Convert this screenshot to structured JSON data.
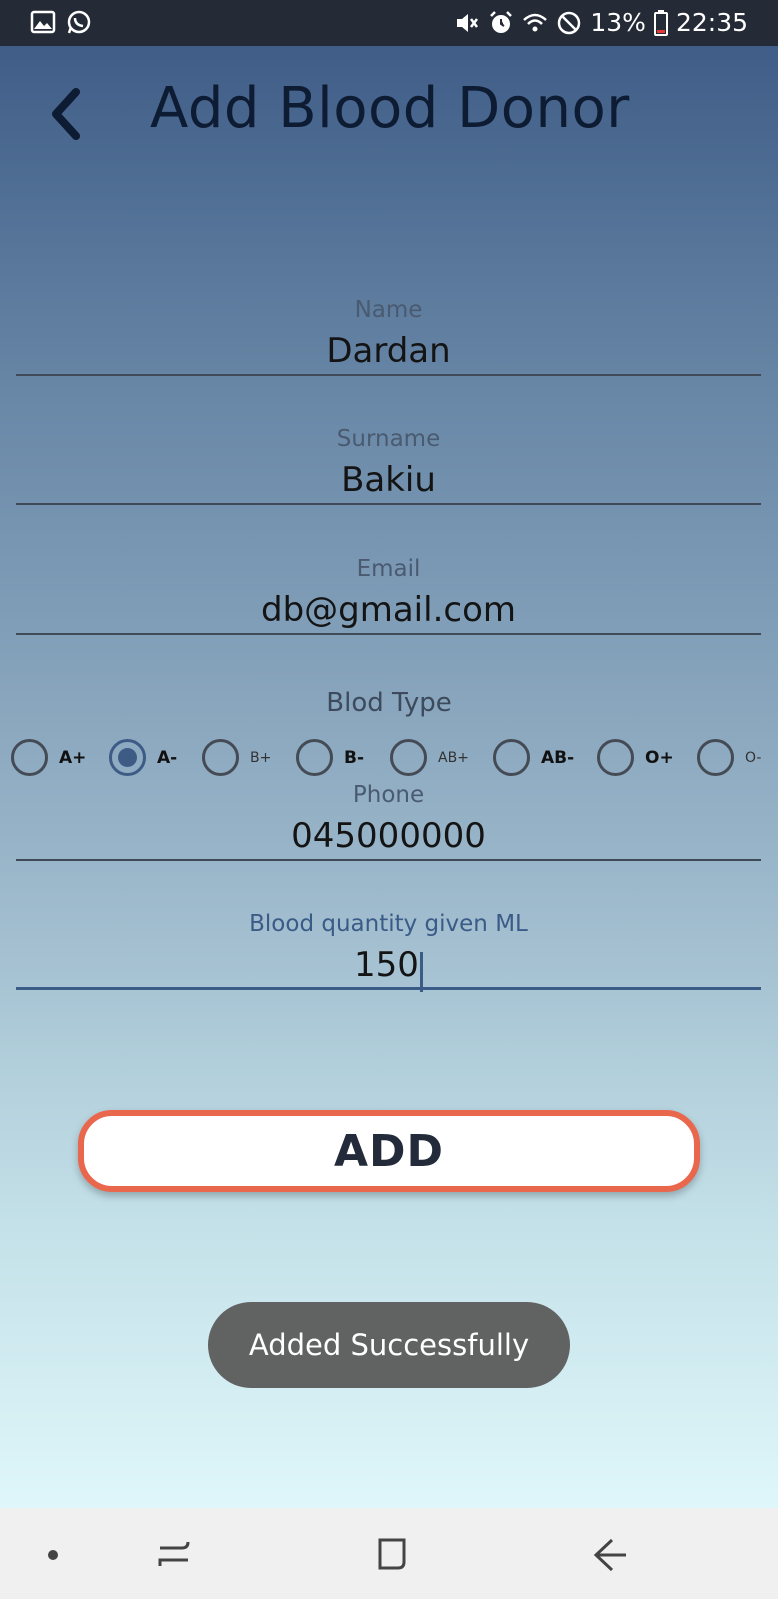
{
  "status_bar": {
    "battery": "13%",
    "time": "22:35",
    "icons": [
      "image-icon",
      "whatsapp-icon",
      "mute-icon",
      "alarm-icon",
      "wifi-icon",
      "do-not-disturb-icon",
      "battery-icon"
    ]
  },
  "header": {
    "title": "Add Blood Donor",
    "back_icon": "chevron-left-icon"
  },
  "form": {
    "name": {
      "label": "Name",
      "value": "Dardan"
    },
    "surname": {
      "label": "Surname",
      "value": "Bakiu"
    },
    "email": {
      "label": "Email",
      "value": "db@gmail.com"
    },
    "blood_type": {
      "label": "Blod Type",
      "options": [
        "A+",
        "A-",
        "B+",
        "B-",
        "AB+",
        "AB-",
        "O+",
        "O-"
      ],
      "selected": "A-"
    },
    "phone": {
      "label": "Phone",
      "value": "045000000"
    },
    "quantity": {
      "label": "Blood quantity given ML",
      "value": "150"
    }
  },
  "add_button": {
    "label": "ADD"
  },
  "toast": {
    "message": "Added Successfully"
  },
  "nav_bar": {
    "icons": [
      "dot-icon",
      "recent-apps-icon",
      "home-icon",
      "back-arrow-icon"
    ]
  },
  "colors": {
    "accent": "#3d5b85",
    "button_border": "#e8674d",
    "status_bar": "#252b36",
    "toast": "#616262"
  }
}
